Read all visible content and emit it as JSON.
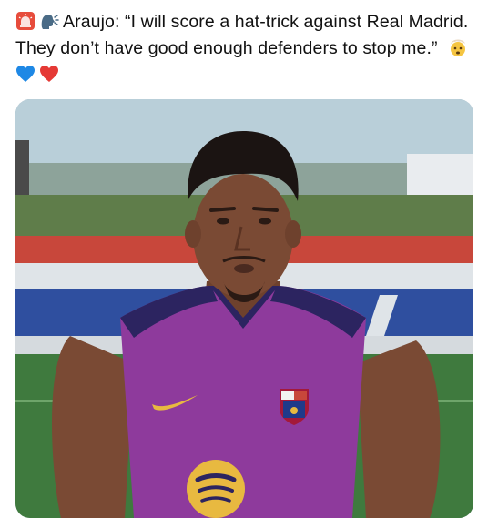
{
  "tweet": {
    "text": "Araujo: “I will score a hat-trick against Real Madrid. They don’t have good enough defenders to stop me.”",
    "leading_icons": [
      "siren-icon",
      "speaking-head-icon"
    ],
    "trailing_icons": [
      "exploding-head-icon",
      "blue-heart-icon",
      "red-heart-icon"
    ]
  },
  "media": {
    "description_icon": "video-thumbnail",
    "colors": {
      "shirt": "#8e3a9c",
      "shirt_trim": "#2c2460",
      "skin": "#7a4a34",
      "grass": "#3f7a3e",
      "stand_red": "#c8473b",
      "stand_blue": "#2f4f9f",
      "sponsor_gold": "#e8b940"
    }
  }
}
